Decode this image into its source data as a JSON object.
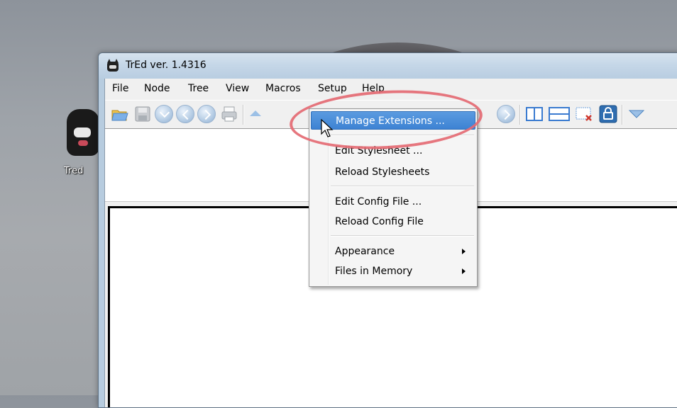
{
  "desktop": {
    "icon_label": "Tred"
  },
  "window": {
    "title": "TrEd ver. 1.4316"
  },
  "menubar": {
    "items": [
      {
        "label": "File"
      },
      {
        "label": "Node"
      },
      {
        "label": "Tree"
      },
      {
        "label": "View"
      },
      {
        "label": "Macros"
      },
      {
        "label": "Setup"
      },
      {
        "label": "Help"
      }
    ]
  },
  "toolbar": {
    "icons": [
      "open-folder-icon",
      "save-icon",
      "circle-down-icon",
      "circle-back-icon",
      "circle-forward-icon",
      "print-icon",
      "circle-up-icon",
      "circle-next-icon",
      "split-vertical-icon",
      "split-horizontal-icon",
      "close-pane-icon",
      "lock-icon",
      "triangle-icon"
    ]
  },
  "setup_menu": {
    "items": [
      {
        "label": "Manage Extensions ...",
        "highlighted": true
      },
      {
        "label": "Edit Stylesheet ..."
      },
      {
        "label": "Reload Stylesheets"
      },
      {
        "label": "Edit Config File ..."
      },
      {
        "label": "Reload Config File"
      },
      {
        "label": "Appearance",
        "submenu": true
      },
      {
        "label": "Files in Memory",
        "submenu": true
      }
    ]
  },
  "colors": {
    "highlight": "#3d82d3",
    "annotation_ring": "#e46a73"
  }
}
